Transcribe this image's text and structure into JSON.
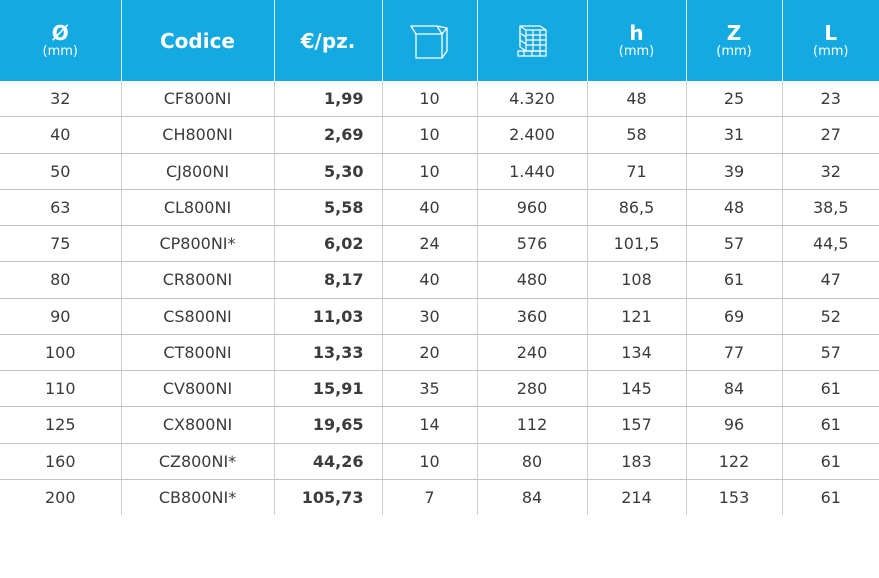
{
  "headers": [
    {
      "main": "Ø",
      "sub": "(mm)"
    },
    {
      "main": "Codice",
      "sub": ""
    },
    {
      "main": "€/pz.",
      "sub": ""
    },
    {
      "main": "",
      "sub": "",
      "icon": "box-icon"
    },
    {
      "main": "",
      "sub": "",
      "icon": "pallet-icon"
    },
    {
      "main": "h",
      "sub": "(mm)"
    },
    {
      "main": "Z",
      "sub": "(mm)"
    },
    {
      "main": "L",
      "sub": "(mm)"
    }
  ],
  "rows": [
    [
      "32",
      "CF800NI",
      "1,99",
      "10",
      "4.320",
      "48",
      "25",
      "23"
    ],
    [
      "40",
      "CH800NI",
      "2,69",
      "10",
      "2.400",
      "58",
      "31",
      "27"
    ],
    [
      "50",
      "CJ800NI",
      "5,30",
      "10",
      "1.440",
      "71",
      "39",
      "32"
    ],
    [
      "63",
      "CL800NI",
      "5,58",
      "40",
      "960",
      "86,5",
      "48",
      "38,5"
    ],
    [
      "75",
      "CP800NI*",
      "6,02",
      "24",
      "576",
      "101,5",
      "57",
      "44,5"
    ],
    [
      "80",
      "CR800NI",
      "8,17",
      "40",
      "480",
      "108",
      "61",
      "47"
    ],
    [
      "90",
      "CS800NI",
      "11,03",
      "30",
      "360",
      "121",
      "69",
      "52"
    ],
    [
      "100",
      "CT800NI",
      "13,33",
      "20",
      "240",
      "134",
      "77",
      "57"
    ],
    [
      "110",
      "CV800NI",
      "15,91",
      "35",
      "280",
      "145",
      "84",
      "61"
    ],
    [
      "125",
      "CX800NI",
      "19,65",
      "14",
      "112",
      "157",
      "96",
      "61"
    ],
    [
      "160",
      "CZ800NI*",
      "44,26",
      "10",
      "80",
      "183",
      "122",
      "61"
    ],
    [
      "200",
      "CB800NI*",
      "105,73",
      "7",
      "84",
      "214",
      "153",
      "61"
    ]
  ],
  "colors": {
    "header_bg": "#14a9e1",
    "header_text": "#ffffff",
    "body_text": "#3b3b3b",
    "grid": "#c4c4c4"
  }
}
